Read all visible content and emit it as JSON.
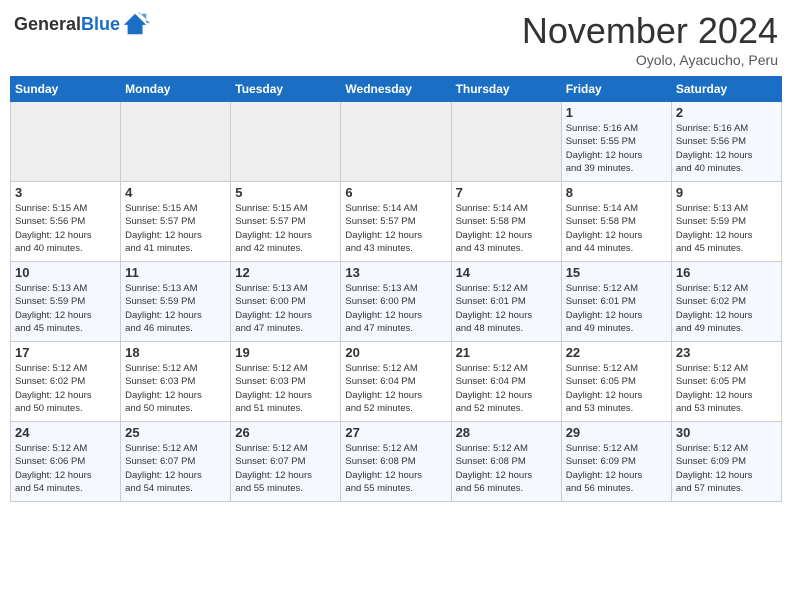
{
  "header": {
    "logo_general": "General",
    "logo_blue": "Blue",
    "month_title": "November 2024",
    "subtitle": "Oyolo, Ayacucho, Peru"
  },
  "weekdays": [
    "Sunday",
    "Monday",
    "Tuesday",
    "Wednesday",
    "Thursday",
    "Friday",
    "Saturday"
  ],
  "weeks": [
    [
      {
        "day": "",
        "info": ""
      },
      {
        "day": "",
        "info": ""
      },
      {
        "day": "",
        "info": ""
      },
      {
        "day": "",
        "info": ""
      },
      {
        "day": "",
        "info": ""
      },
      {
        "day": "1",
        "info": "Sunrise: 5:16 AM\nSunset: 5:55 PM\nDaylight: 12 hours\nand 39 minutes."
      },
      {
        "day": "2",
        "info": "Sunrise: 5:16 AM\nSunset: 5:56 PM\nDaylight: 12 hours\nand 40 minutes."
      }
    ],
    [
      {
        "day": "3",
        "info": "Sunrise: 5:15 AM\nSunset: 5:56 PM\nDaylight: 12 hours\nand 40 minutes."
      },
      {
        "day": "4",
        "info": "Sunrise: 5:15 AM\nSunset: 5:57 PM\nDaylight: 12 hours\nand 41 minutes."
      },
      {
        "day": "5",
        "info": "Sunrise: 5:15 AM\nSunset: 5:57 PM\nDaylight: 12 hours\nand 42 minutes."
      },
      {
        "day": "6",
        "info": "Sunrise: 5:14 AM\nSunset: 5:57 PM\nDaylight: 12 hours\nand 43 minutes."
      },
      {
        "day": "7",
        "info": "Sunrise: 5:14 AM\nSunset: 5:58 PM\nDaylight: 12 hours\nand 43 minutes."
      },
      {
        "day": "8",
        "info": "Sunrise: 5:14 AM\nSunset: 5:58 PM\nDaylight: 12 hours\nand 44 minutes."
      },
      {
        "day": "9",
        "info": "Sunrise: 5:13 AM\nSunset: 5:59 PM\nDaylight: 12 hours\nand 45 minutes."
      }
    ],
    [
      {
        "day": "10",
        "info": "Sunrise: 5:13 AM\nSunset: 5:59 PM\nDaylight: 12 hours\nand 45 minutes."
      },
      {
        "day": "11",
        "info": "Sunrise: 5:13 AM\nSunset: 5:59 PM\nDaylight: 12 hours\nand 46 minutes."
      },
      {
        "day": "12",
        "info": "Sunrise: 5:13 AM\nSunset: 6:00 PM\nDaylight: 12 hours\nand 47 minutes."
      },
      {
        "day": "13",
        "info": "Sunrise: 5:13 AM\nSunset: 6:00 PM\nDaylight: 12 hours\nand 47 minutes."
      },
      {
        "day": "14",
        "info": "Sunrise: 5:12 AM\nSunset: 6:01 PM\nDaylight: 12 hours\nand 48 minutes."
      },
      {
        "day": "15",
        "info": "Sunrise: 5:12 AM\nSunset: 6:01 PM\nDaylight: 12 hours\nand 49 minutes."
      },
      {
        "day": "16",
        "info": "Sunrise: 5:12 AM\nSunset: 6:02 PM\nDaylight: 12 hours\nand 49 minutes."
      }
    ],
    [
      {
        "day": "17",
        "info": "Sunrise: 5:12 AM\nSunset: 6:02 PM\nDaylight: 12 hours\nand 50 minutes."
      },
      {
        "day": "18",
        "info": "Sunrise: 5:12 AM\nSunset: 6:03 PM\nDaylight: 12 hours\nand 50 minutes."
      },
      {
        "day": "19",
        "info": "Sunrise: 5:12 AM\nSunset: 6:03 PM\nDaylight: 12 hours\nand 51 minutes."
      },
      {
        "day": "20",
        "info": "Sunrise: 5:12 AM\nSunset: 6:04 PM\nDaylight: 12 hours\nand 52 minutes."
      },
      {
        "day": "21",
        "info": "Sunrise: 5:12 AM\nSunset: 6:04 PM\nDaylight: 12 hours\nand 52 minutes."
      },
      {
        "day": "22",
        "info": "Sunrise: 5:12 AM\nSunset: 6:05 PM\nDaylight: 12 hours\nand 53 minutes."
      },
      {
        "day": "23",
        "info": "Sunrise: 5:12 AM\nSunset: 6:05 PM\nDaylight: 12 hours\nand 53 minutes."
      }
    ],
    [
      {
        "day": "24",
        "info": "Sunrise: 5:12 AM\nSunset: 6:06 PM\nDaylight: 12 hours\nand 54 minutes."
      },
      {
        "day": "25",
        "info": "Sunrise: 5:12 AM\nSunset: 6:07 PM\nDaylight: 12 hours\nand 54 minutes."
      },
      {
        "day": "26",
        "info": "Sunrise: 5:12 AM\nSunset: 6:07 PM\nDaylight: 12 hours\nand 55 minutes."
      },
      {
        "day": "27",
        "info": "Sunrise: 5:12 AM\nSunset: 6:08 PM\nDaylight: 12 hours\nand 55 minutes."
      },
      {
        "day": "28",
        "info": "Sunrise: 5:12 AM\nSunset: 6:08 PM\nDaylight: 12 hours\nand 56 minutes."
      },
      {
        "day": "29",
        "info": "Sunrise: 5:12 AM\nSunset: 6:09 PM\nDaylight: 12 hours\nand 56 minutes."
      },
      {
        "day": "30",
        "info": "Sunrise: 5:12 AM\nSunset: 6:09 PM\nDaylight: 12 hours\nand 57 minutes."
      }
    ]
  ]
}
